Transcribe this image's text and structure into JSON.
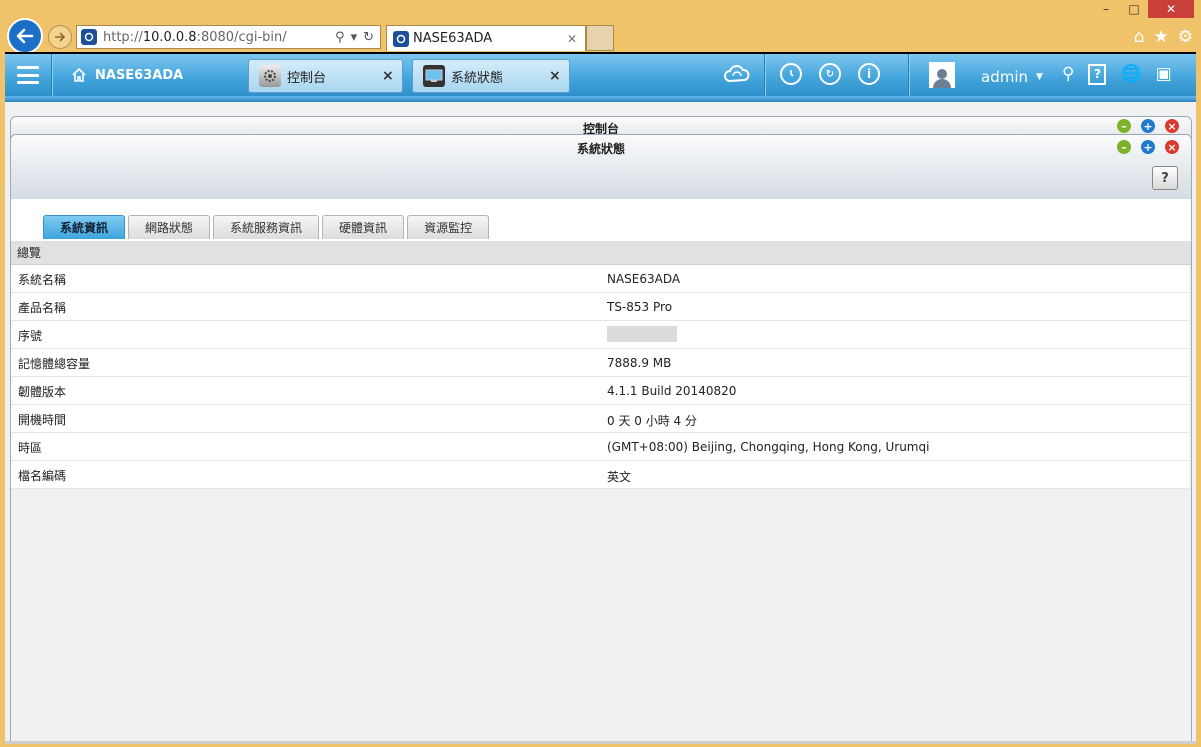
{
  "browser": {
    "url_prefix": "http://",
    "url_host": "10.0.0.8",
    "url_rest": ":8080/cgi-bin/",
    "tab_title": "NASE63ADA"
  },
  "header": {
    "device_name": "NASE63ADA",
    "tabs": [
      {
        "label": "控制台",
        "icon": "gear-icon"
      },
      {
        "label": "系統狀態",
        "icon": "monitor-icon"
      }
    ],
    "username": "admin",
    "accent_color": "#3b9ad8"
  },
  "windows": {
    "control_panel_title": "控制台",
    "system_status_title": "系統狀態"
  },
  "status": {
    "tabs": [
      "系統資訊",
      "網路狀態",
      "系統服務資訊",
      "硬體資訊",
      "資源監控"
    ],
    "active_tab": "系統資訊",
    "section_title": "總覽",
    "rows": [
      {
        "key": "系統名稱",
        "value": "NASE63ADA"
      },
      {
        "key": "產品名稱",
        "value": "TS-853 Pro"
      },
      {
        "key": "序號",
        "value": ""
      },
      {
        "key": "記憶體總容量",
        "value": "7888.9 MB"
      },
      {
        "key": "韌體版本",
        "value": "4.1.1 Build 20140820"
      },
      {
        "key": "開機時間",
        "value": "0 天 0 小時 4 分"
      },
      {
        "key": "時區",
        "value": "(GMT+08:00) Beijing, Chongqing, Hong Kong, Urumqi"
      },
      {
        "key": "檔名編碼",
        "value": "英文"
      }
    ]
  }
}
